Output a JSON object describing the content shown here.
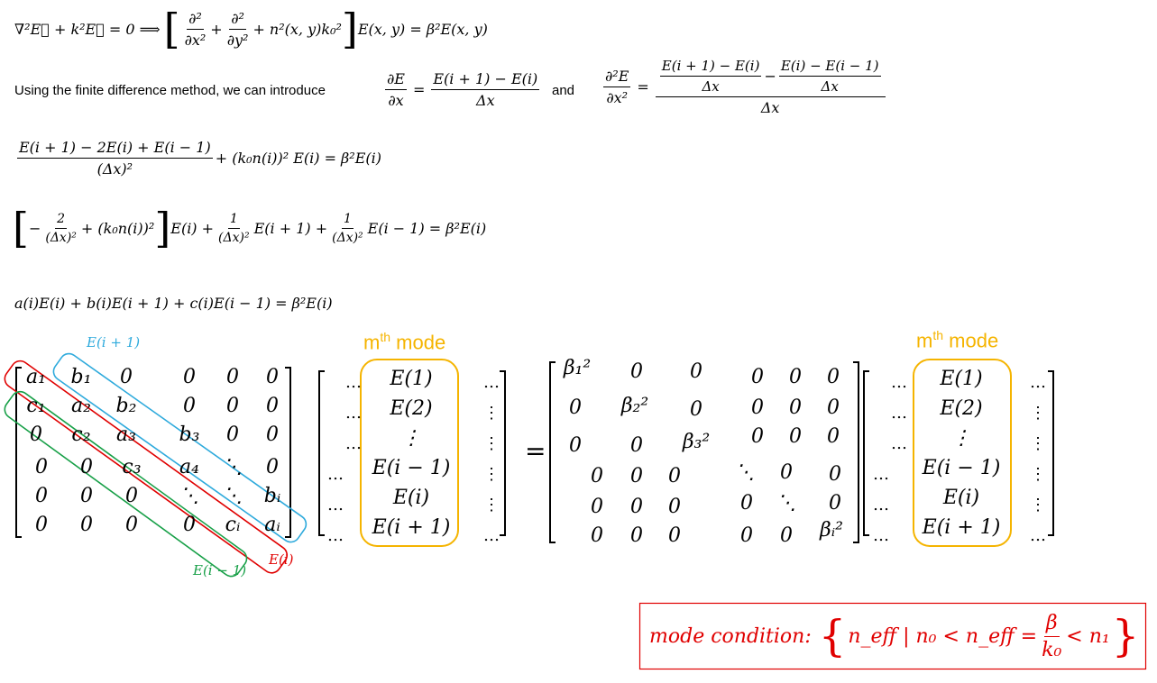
{
  "line1": "∇²E⃗ + k²E⃗ = 0 ⟹",
  "line1_d2x_num": "∂²",
  "line1_d2x_den": "∂x²",
  "line1_d2y_num": "∂²",
  "line1_d2y_den": "∂y²",
  "line1_rest_inner": "+ n²(x, y)k₀²",
  "line1_rest": "E(x, y) = β²E(x, y)",
  "fd_text": "Using the finite difference method, we can introduce",
  "fd1_lhs_num": "∂E",
  "fd1_lhs_den": "∂x",
  "fd1_num": "E(i + 1) − E(i)",
  "fd1_den": "Δx",
  "and": "and",
  "fd2_lhs_num": "∂²E",
  "fd2_lhs_den": "∂x²",
  "fd2_inner1_num": "E(i + 1) − E(i)",
  "fd2_inner1_den": "Δx",
  "fd2_inner2_num": "E(i) − E(i − 1)",
  "fd2_inner2_den": "Δx",
  "fd2_den": "Δx",
  "eq3_num": "E(i + 1) − 2E(i) + E(i − 1)",
  "eq3_den": "(Δx)²",
  "eq3_rest": "+ (k₀n(i))² E(i) = β²E(i)",
  "eq4_a": "2",
  "eq4_a_den": "(Δx)²",
  "eq4_b": "+ (k₀n(i))²",
  "eq4_c": "E(i) +",
  "eq4_one": "1",
  "eq4_d": "E(i + 1) +",
  "eq4_e": "E(i − 1) = β²E(i)",
  "eq5": "a(i)E(i) + b(i)E(i + 1) + c(i)E(i − 1) = β²E(i)",
  "label_b": "E(i + 1)",
  "label_a": "E(i)",
  "label_c": "E(i − 1)",
  "mode_label_left": "mth mode",
  "mode_label_right": "mth mode",
  "mode_sup": "th",
  "mode_m": "m",
  "mode_word": "mode",
  "matrixA": [
    [
      "a₁",
      "b₁",
      "0",
      "0",
      "0",
      "0"
    ],
    [
      "c₁",
      "a₂",
      "b₂",
      "0",
      "0",
      "0"
    ],
    [
      "0",
      "c₂",
      "a₃",
      "b₃",
      "0",
      "0"
    ],
    [
      "0",
      "0",
      "c₃",
      "a₄",
      "⋱",
      "0"
    ],
    [
      "0",
      "0",
      "0",
      "⋱",
      "⋱",
      "bᵢ"
    ],
    [
      "0",
      "0",
      "0",
      "0",
      "cᵢ",
      "aᵢ"
    ]
  ],
  "vecE": [
    "E(1)",
    "E(2)",
    "⋮",
    "E(i − 1)",
    "E(i)",
    "E(i + 1)"
  ],
  "dots": "…",
  "vdots": "⋮",
  "equals": "=",
  "diag": {
    "b1": "β₁²",
    "b2": "β₂²",
    "b3": "β₃²",
    "bi": "βᵢ²",
    "zero": "0",
    "ddots": "⋱"
  },
  "cond_label": "mode condition:",
  "cond_body": "n_eff | n₀ < n_eff =",
  "cond_frac_num": "β",
  "cond_frac_den": "k₀",
  "cond_tail": "< n₁",
  "colors": {
    "blue": "#2eaadc",
    "red": "#e00000",
    "green": "#18a048",
    "orange": "#f5b400"
  }
}
